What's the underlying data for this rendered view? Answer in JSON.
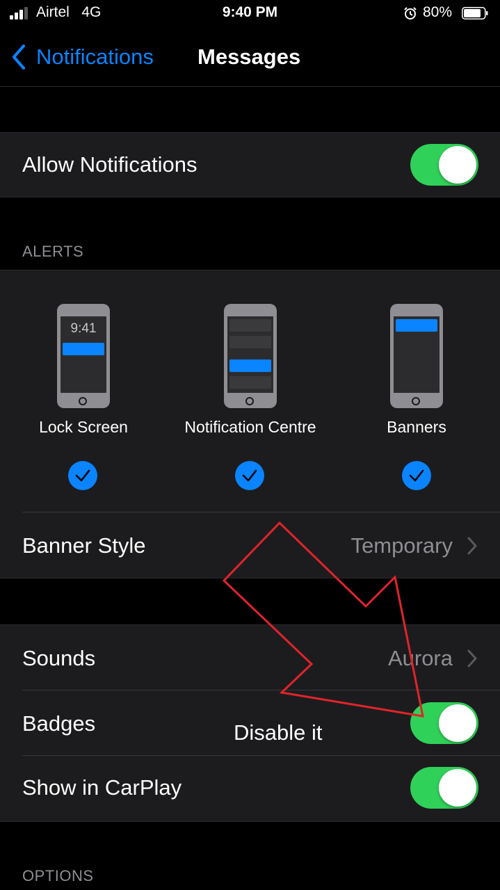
{
  "status_bar": {
    "carrier": "Airtel   4G",
    "time": "9:40 PM",
    "battery": "80%",
    "icons": [
      "signal-icon",
      "alarm-icon",
      "battery-icon"
    ]
  },
  "nav": {
    "back_label": "Notifications",
    "title": "Messages"
  },
  "allow_notifications": {
    "label": "Allow Notifications",
    "enabled": true
  },
  "alerts": {
    "header": "ALERTS",
    "lock_time": "9:41",
    "options": [
      {
        "label": "Lock Screen",
        "checked": true
      },
      {
        "label": "Notification Centre",
        "checked": true
      },
      {
        "label": "Banners",
        "checked": true
      }
    ],
    "banner_style": {
      "label": "Banner Style",
      "value": "Temporary"
    }
  },
  "sounds": {
    "label": "Sounds",
    "value": "Aurora"
  },
  "badges": {
    "label": "Badges",
    "enabled": true
  },
  "carplay": {
    "label": "Show in CarPlay",
    "enabled": true
  },
  "options_header": "OPTIONS",
  "annotation": {
    "text": "Disable it",
    "color": "#e0242b"
  },
  "colors": {
    "accent": "#0a84ff",
    "toggle_on": "#30d158",
    "background": "#000000",
    "cell": "#1c1c1e"
  }
}
